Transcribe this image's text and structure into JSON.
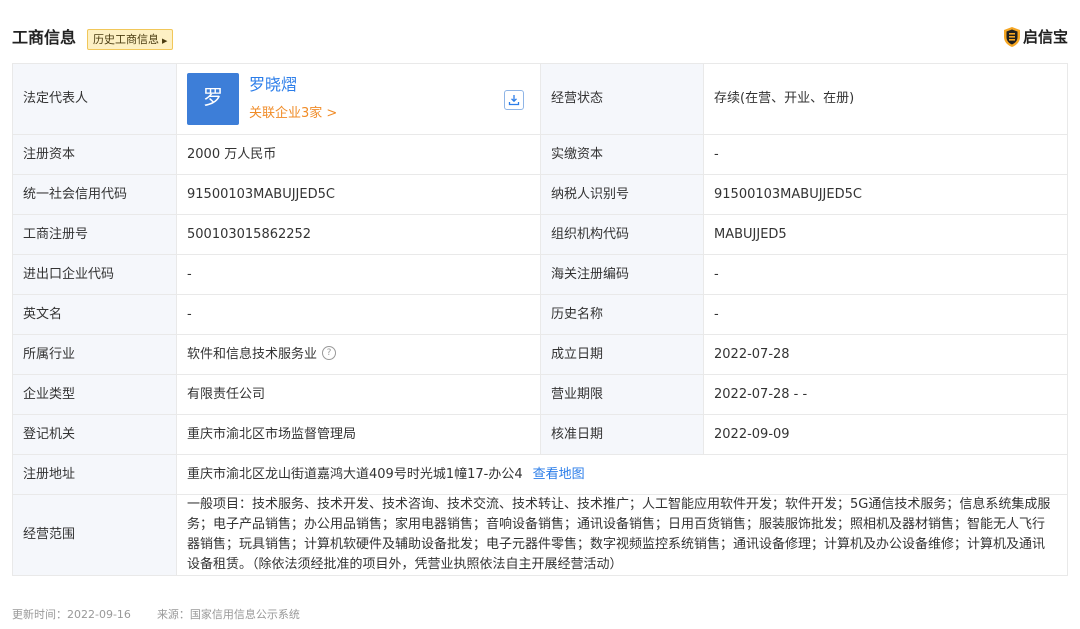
{
  "header": {
    "title": "工商信息",
    "history_tag": "历史工商信息",
    "brand": "启信宝"
  },
  "legal_rep": {
    "label": "法定代表人",
    "avatar_char": "罗",
    "name": "罗晓熠",
    "related": "关联企业3家 >"
  },
  "status": {
    "label": "经营状态",
    "value": "存续(在营、开业、在册)"
  },
  "rows": [
    {
      "l1": "注册资本",
      "v1": "2000 万人民币",
      "l2": "实缴资本",
      "v2": "-"
    },
    {
      "l1": "统一社会信用代码",
      "v1": "91500103MABUJJED5C",
      "l2": "纳税人识别号",
      "v2": "91500103MABUJJED5C"
    },
    {
      "l1": "工商注册号",
      "v1": "500103015862252",
      "l2": "组织机构代码",
      "v2": "MABUJJED5"
    },
    {
      "l1": "进出口企业代码",
      "v1": "-",
      "l2": "海关注册编码",
      "v2": "-"
    },
    {
      "l1": "英文名",
      "v1": "-",
      "l2": "历史名称",
      "v2": "-"
    },
    {
      "l1": "所属行业",
      "v1": "软件和信息技术服务业",
      "l2": "成立日期",
      "v2": "2022-07-28"
    },
    {
      "l1": "企业类型",
      "v1": "有限责任公司",
      "l2": "营业期限",
      "v2": "2022-07-28 - -"
    },
    {
      "l1": "登记机关",
      "v1": "重庆市渝北区市场监督管理局",
      "l2": "核准日期",
      "v2": "2022-09-09"
    }
  ],
  "address": {
    "label": "注册地址",
    "value": "重庆市渝北区龙山街道嘉鸿大道409号时光城1幢17-办公4",
    "map_link": "查看地图"
  },
  "scope": {
    "label": "经营范围",
    "value": "一般项目：技术服务、技术开发、技术咨询、技术交流、技术转让、技术推广；人工智能应用软件开发；软件开发；5G通信技术服务；信息系统集成服务；电子产品销售；办公用品销售；家用电器销售；音响设备销售；通讯设备销售；日用百货销售；服装服饰批发；照相机及器材销售；智能无人飞行器销售；玩具销售；计算机软硬件及辅助设备批发；电子元器件零售；数字视频监控系统销售；通讯设备修理；计算机及办公设备维修；计算机及通讯设备租赁。（除依法须经批准的项目外，凭营业执照依法自主开展经营活动）"
  },
  "footer": {
    "update_time": "更新时间：2022-09-16",
    "source": "来源：国家信用信息公示系统"
  },
  "colors": {
    "accent_blue": "#2b7de9",
    "accent_orange": "#f08c28",
    "label_bg": "#f5f7fb"
  }
}
